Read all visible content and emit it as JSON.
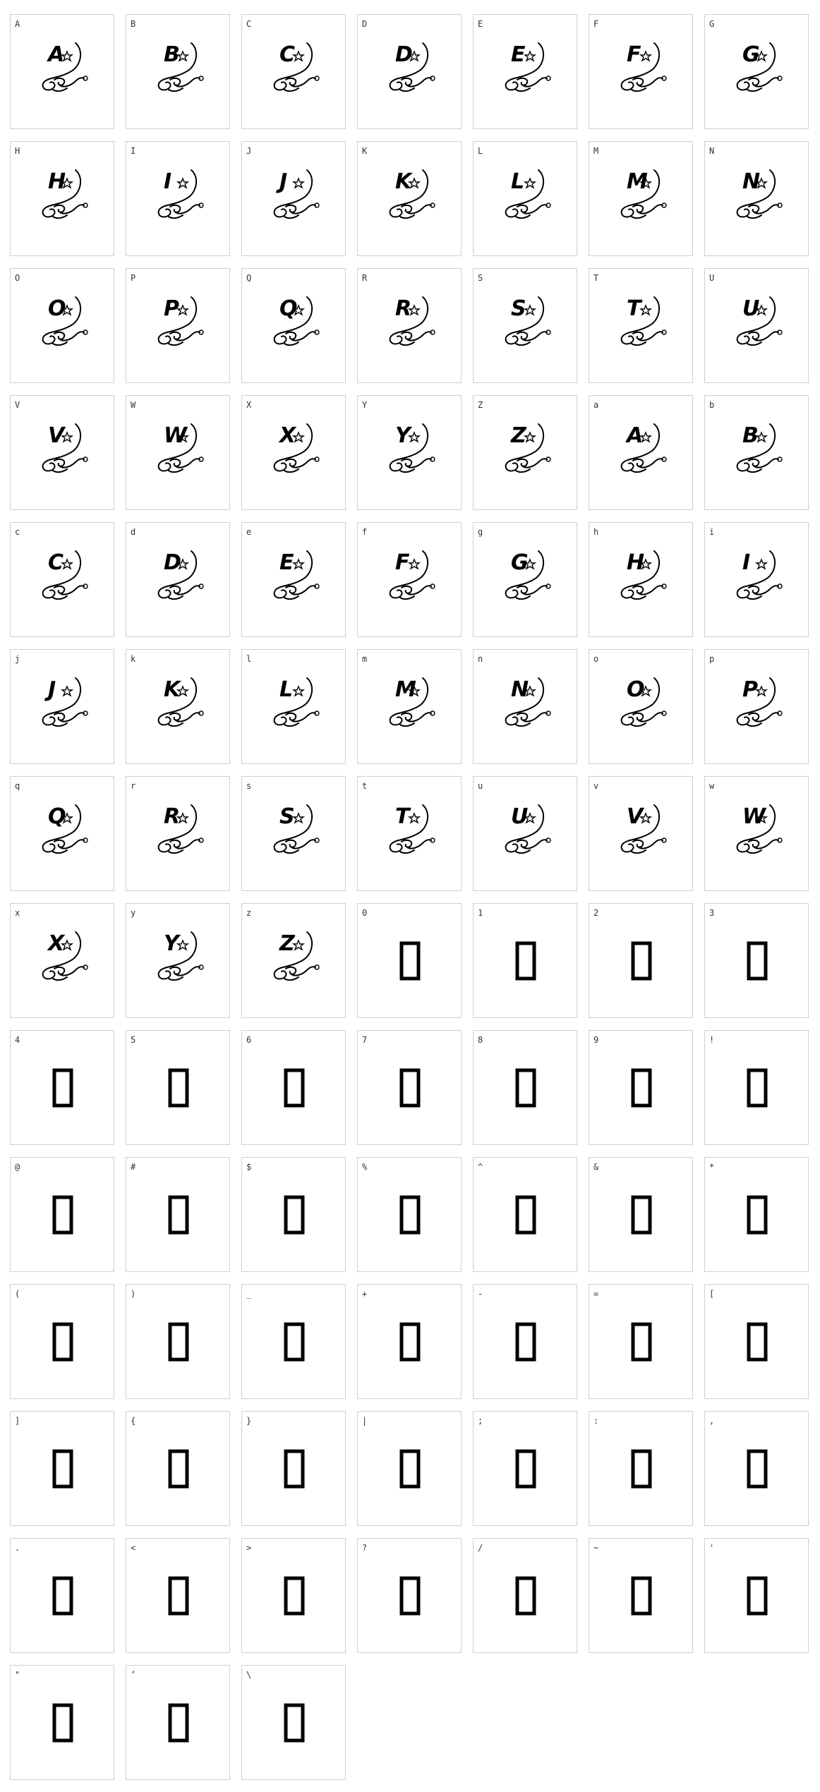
{
  "grid": {
    "cells": [
      {
        "label": "A",
        "glyph": "A",
        "kind": "ornament"
      },
      {
        "label": "B",
        "glyph": "B",
        "kind": "ornament"
      },
      {
        "label": "C",
        "glyph": "C",
        "kind": "ornament"
      },
      {
        "label": "D",
        "glyph": "D",
        "kind": "ornament"
      },
      {
        "label": "E",
        "glyph": "E",
        "kind": "ornament"
      },
      {
        "label": "F",
        "glyph": "F",
        "kind": "ornament"
      },
      {
        "label": "G",
        "glyph": "G",
        "kind": "ornament"
      },
      {
        "label": "H",
        "glyph": "H",
        "kind": "ornament"
      },
      {
        "label": "I",
        "glyph": "I",
        "kind": "ornament"
      },
      {
        "label": "J",
        "glyph": "J",
        "kind": "ornament"
      },
      {
        "label": "K",
        "glyph": "K",
        "kind": "ornament"
      },
      {
        "label": "L",
        "glyph": "L",
        "kind": "ornament"
      },
      {
        "label": "M",
        "glyph": "M",
        "kind": "ornament"
      },
      {
        "label": "N",
        "glyph": "N",
        "kind": "ornament"
      },
      {
        "label": "O",
        "glyph": "O",
        "kind": "ornament"
      },
      {
        "label": "P",
        "glyph": "P",
        "kind": "ornament"
      },
      {
        "label": "Q",
        "glyph": "Q",
        "kind": "ornament"
      },
      {
        "label": "R",
        "glyph": "R",
        "kind": "ornament"
      },
      {
        "label": "S",
        "glyph": "S",
        "kind": "ornament"
      },
      {
        "label": "T",
        "glyph": "T",
        "kind": "ornament"
      },
      {
        "label": "U",
        "glyph": "U",
        "kind": "ornament"
      },
      {
        "label": "V",
        "glyph": "V",
        "kind": "ornament"
      },
      {
        "label": "W",
        "glyph": "W",
        "kind": "ornament"
      },
      {
        "label": "X",
        "glyph": "X",
        "kind": "ornament"
      },
      {
        "label": "Y",
        "glyph": "Y",
        "kind": "ornament"
      },
      {
        "label": "Z",
        "glyph": "Z",
        "kind": "ornament"
      },
      {
        "label": "a",
        "glyph": "A",
        "kind": "ornament"
      },
      {
        "label": "b",
        "glyph": "B",
        "kind": "ornament"
      },
      {
        "label": "c",
        "glyph": "C",
        "kind": "ornament"
      },
      {
        "label": "d",
        "glyph": "D",
        "kind": "ornament"
      },
      {
        "label": "e",
        "glyph": "E",
        "kind": "ornament"
      },
      {
        "label": "f",
        "glyph": "F",
        "kind": "ornament"
      },
      {
        "label": "g",
        "glyph": "G",
        "kind": "ornament"
      },
      {
        "label": "h",
        "glyph": "H",
        "kind": "ornament"
      },
      {
        "label": "i",
        "glyph": "I",
        "kind": "ornament"
      },
      {
        "label": "j",
        "glyph": "J",
        "kind": "ornament"
      },
      {
        "label": "k",
        "glyph": "K",
        "kind": "ornament"
      },
      {
        "label": "l",
        "glyph": "L",
        "kind": "ornament"
      },
      {
        "label": "m",
        "glyph": "M",
        "kind": "ornament"
      },
      {
        "label": "n",
        "glyph": "N",
        "kind": "ornament"
      },
      {
        "label": "o",
        "glyph": "O",
        "kind": "ornament"
      },
      {
        "label": "p",
        "glyph": "P",
        "kind": "ornament"
      },
      {
        "label": "q",
        "glyph": "Q",
        "kind": "ornament"
      },
      {
        "label": "r",
        "glyph": "R",
        "kind": "ornament"
      },
      {
        "label": "s",
        "glyph": "S",
        "kind": "ornament"
      },
      {
        "label": "t",
        "glyph": "T",
        "kind": "ornament"
      },
      {
        "label": "u",
        "glyph": "U",
        "kind": "ornament"
      },
      {
        "label": "v",
        "glyph": "V",
        "kind": "ornament"
      },
      {
        "label": "w",
        "glyph": "W",
        "kind": "ornament"
      },
      {
        "label": "x",
        "glyph": "X",
        "kind": "ornament"
      },
      {
        "label": "y",
        "glyph": "Y",
        "kind": "ornament"
      },
      {
        "label": "z",
        "glyph": "Z",
        "kind": "ornament"
      },
      {
        "label": "0",
        "kind": "notdef"
      },
      {
        "label": "1",
        "kind": "notdef"
      },
      {
        "label": "2",
        "kind": "notdef"
      },
      {
        "label": "3",
        "kind": "notdef"
      },
      {
        "label": "4",
        "kind": "notdef"
      },
      {
        "label": "5",
        "kind": "notdef"
      },
      {
        "label": "6",
        "kind": "notdef"
      },
      {
        "label": "7",
        "kind": "notdef"
      },
      {
        "label": "8",
        "kind": "notdef"
      },
      {
        "label": "9",
        "kind": "notdef"
      },
      {
        "label": "!",
        "kind": "notdef"
      },
      {
        "label": "@",
        "kind": "notdef"
      },
      {
        "label": "#",
        "kind": "notdef"
      },
      {
        "label": "$",
        "kind": "notdef"
      },
      {
        "label": "%",
        "kind": "notdef"
      },
      {
        "label": "^",
        "kind": "notdef"
      },
      {
        "label": "&",
        "kind": "notdef"
      },
      {
        "label": "*",
        "kind": "notdef"
      },
      {
        "label": "(",
        "kind": "notdef"
      },
      {
        "label": ")",
        "kind": "notdef"
      },
      {
        "label": "_",
        "kind": "notdef"
      },
      {
        "label": "+",
        "kind": "notdef"
      },
      {
        "label": "-",
        "kind": "notdef"
      },
      {
        "label": "=",
        "kind": "notdef"
      },
      {
        "label": "[",
        "kind": "notdef"
      },
      {
        "label": "]",
        "kind": "notdef"
      },
      {
        "label": "{",
        "kind": "notdef"
      },
      {
        "label": "}",
        "kind": "notdef"
      },
      {
        "label": "|",
        "kind": "notdef"
      },
      {
        "label": ";",
        "kind": "notdef"
      },
      {
        "label": ":",
        "kind": "notdef"
      },
      {
        "label": ",",
        "kind": "notdef"
      },
      {
        "label": ".",
        "kind": "notdef"
      },
      {
        "label": "<",
        "kind": "notdef"
      },
      {
        "label": ">",
        "kind": "notdef"
      },
      {
        "label": "?",
        "kind": "notdef"
      },
      {
        "label": "/",
        "kind": "notdef"
      },
      {
        "label": "~",
        "kind": "notdef"
      },
      {
        "label": "'",
        "kind": "notdef"
      },
      {
        "label": "\"",
        "kind": "notdef"
      },
      {
        "label": "’",
        "kind": "notdef"
      },
      {
        "label": "\\",
        "kind": "notdef"
      }
    ]
  }
}
